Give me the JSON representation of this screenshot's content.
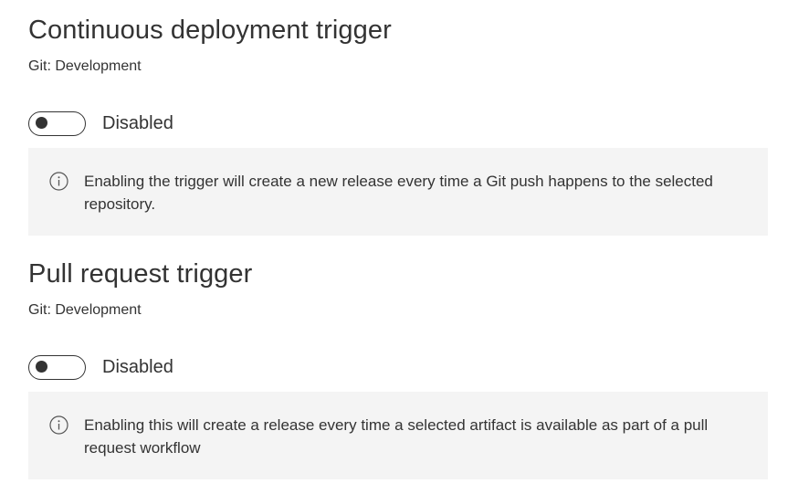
{
  "triggers": [
    {
      "title": "Continuous deployment trigger",
      "source": "Git: Development",
      "toggle_label": "Disabled",
      "enabled": false,
      "info_icon": "info-circle-icon",
      "info_text": "Enabling the trigger will create a new release every time a Git push happens to the selected repository."
    },
    {
      "title": "Pull request trigger",
      "source": "Git: Development",
      "toggle_label": "Disabled",
      "enabled": false,
      "info_icon": "info-circle-icon",
      "info_text": "Enabling this will create a release every time a selected artifact is available as part of a pull request workflow"
    }
  ],
  "colors": {
    "text": "#333333",
    "info_background": "#f4f4f4",
    "page_background": "#ffffff"
  }
}
